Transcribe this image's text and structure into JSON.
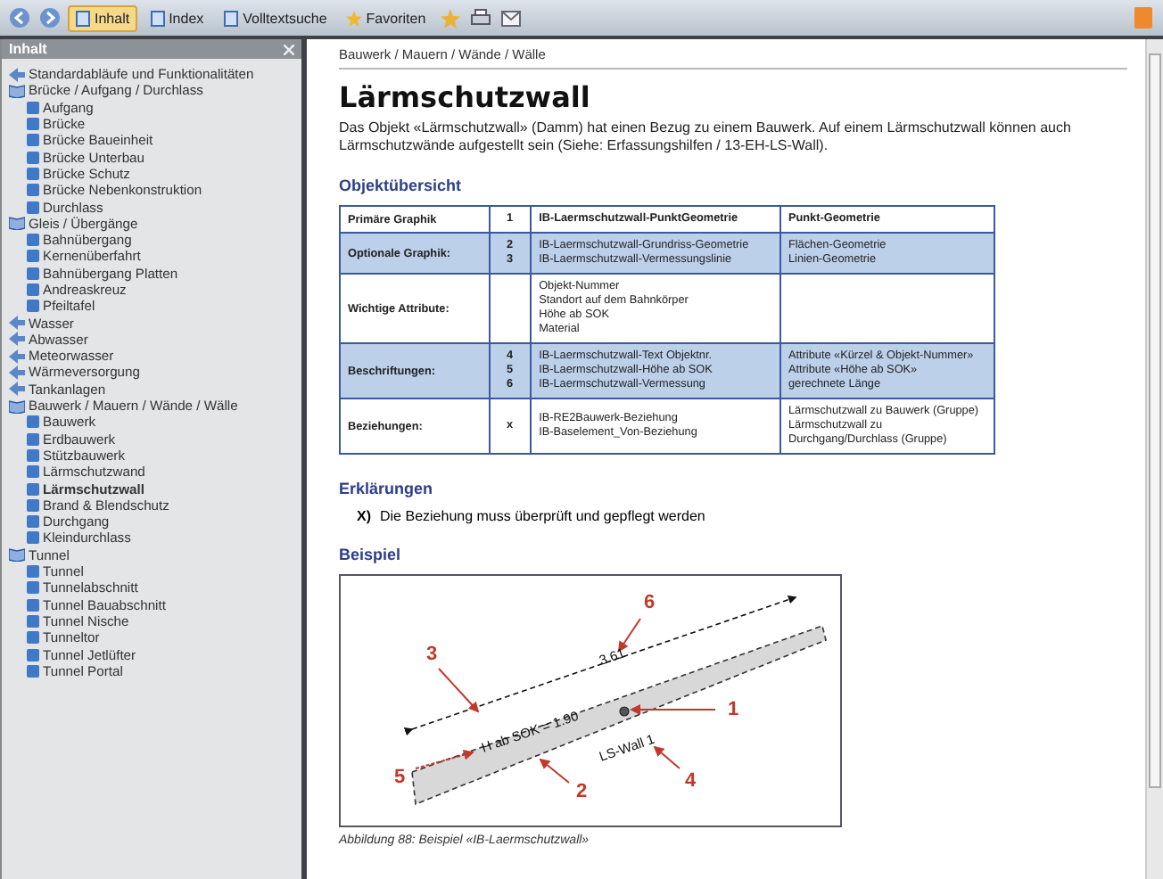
{
  "toolbar": {
    "tabs": [
      {
        "label": "Inhalt",
        "selected": true
      },
      {
        "label": "Index",
        "selected": false
      },
      {
        "label": "Volltextsuche",
        "selected": false
      },
      {
        "label": "Favoriten",
        "selected": false
      }
    ]
  },
  "sidebar": {
    "title": "Inhalt",
    "items": [
      {
        "kind": "doc",
        "label": "Standardabläufe und Funktionalitäten",
        "selected": false
      },
      {
        "kind": "book",
        "label": "Brücke / Aufgang / Durchlass",
        "selected": false,
        "children": [
          {
            "label": "Aufgang",
            "selected": false
          },
          {
            "label": "Brücke",
            "selected": false
          },
          {
            "label": "Brücke Baueinheit",
            "selected": false
          },
          {
            "label": "Brücke Unterbau",
            "selected": false
          },
          {
            "label": "Brücke Schutz",
            "selected": false
          },
          {
            "label": "Brücke Nebenkonstruktion",
            "selected": false
          },
          {
            "label": "Durchlass",
            "selected": false
          }
        ]
      },
      {
        "kind": "book",
        "label": "Gleis / Übergänge",
        "selected": false,
        "children": [
          {
            "label": "Bahnübergang",
            "selected": false
          },
          {
            "label": "Kernenüberfahrt",
            "selected": false
          },
          {
            "label": "Bahnübergang Platten",
            "selected": false
          },
          {
            "label": "Andreaskreuz",
            "selected": false
          },
          {
            "label": "Pfeiltafel",
            "selected": false
          }
        ]
      },
      {
        "kind": "doc",
        "label": "Wasser",
        "selected": false
      },
      {
        "kind": "doc",
        "label": "Abwasser",
        "selected": false
      },
      {
        "kind": "doc",
        "label": "Meteorwasser",
        "selected": false
      },
      {
        "kind": "doc",
        "label": "Wärmeversorgung",
        "selected": false
      },
      {
        "kind": "doc",
        "label": "Tankanlagen",
        "selected": false
      },
      {
        "kind": "book",
        "label": "Bauwerk / Mauern / Wände / Wälle",
        "selected": false,
        "children": [
          {
            "label": "Bauwerk",
            "selected": false
          },
          {
            "label": "Erdbauwerk",
            "selected": false
          },
          {
            "label": "Stützbauwerk",
            "selected": false
          },
          {
            "label": "Lärmschutzwand",
            "selected": false
          },
          {
            "label": "Lärmschutzwall",
            "selected": true
          },
          {
            "label": "Brand & Blendschutz",
            "selected": false
          },
          {
            "label": "Durchgang",
            "selected": false
          },
          {
            "label": "Kleindurchlass",
            "selected": false
          }
        ]
      },
      {
        "kind": "book",
        "label": "Tunnel",
        "selected": false,
        "children": [
          {
            "label": "Tunnel",
            "selected": false
          },
          {
            "label": "Tunnelabschnitt",
            "selected": false
          },
          {
            "label": "Tunnel Bauabschnitt",
            "selected": false
          },
          {
            "label": "Tunnel Nische",
            "selected": false
          },
          {
            "label": "Tunneltor",
            "selected": false
          },
          {
            "label": "Tunnel Jetlüfter",
            "selected": false
          },
          {
            "label": "Tunnel Portal",
            "selected": false
          }
        ]
      }
    ]
  },
  "content": {
    "breadcrumb": "Bauwerk / Mauern / Wände / Wälle",
    "title": "Lärmschutzwall",
    "intro": "Das Objekt «Lärmschutzwall» (Damm) hat einen Bezug zu einem Bauwerk. Auf einem Lärmschutzwall können auch Lärmschutzwände aufgestellt sein (Siehe: Erfassungshilfen / 13-EH-LS-Wall).",
    "overview_heading": "Objektübersicht",
    "table": {
      "rows": [
        {
          "highlighted": false,
          "label": "Primäre Graphik",
          "numbers": [
            "1"
          ],
          "objects": [
            "IB-Laermschutzwall-PunktGeometrie"
          ],
          "types": [
            "Punkt-Geometrie"
          ]
        },
        {
          "highlighted": true,
          "label": "Optionale Graphik:",
          "numbers": [
            "2",
            "3"
          ],
          "objects": [
            "IB-Laermschutzwall-Grundriss-Geometrie",
            "IB-Laermschutzwall-Vermessungslinie"
          ],
          "types": [
            "Flächen-Geometrie",
            "Linien-Geometrie"
          ]
        },
        {
          "highlighted": false,
          "label": "Wichtige Attribute:",
          "numbers": [],
          "objects": [
            "Objekt-Nummer",
            "Standort auf dem Bahnkörper",
            "Höhe ab SOK",
            "Material"
          ],
          "types": []
        },
        {
          "highlighted": true,
          "label": "Beschriftungen:",
          "numbers": [
            "4",
            "5",
            "6"
          ],
          "objects": [
            "IB-Laermschutzwall-Text Objektnr.",
            "IB-Laermschutzwall-Höhe ab SOK",
            "IB-Laermschutzwall-Vermessung"
          ],
          "types": [
            "Attribute «Kürzel & Objekt-Nummer»",
            "Attribute «Höhe ab SOK»",
            "gerechnete Länge"
          ]
        },
        {
          "highlighted": false,
          "label": "Beziehungen:",
          "numbers": [
            "x"
          ],
          "objects": [
            "IB-RE2Bauwerk-Beziehung",
            "IB-Baselement_Von-Beziehung"
          ],
          "types": [
            "Lärmschutzwall zu Bauwerk (Gruppe)",
            "Lärmschutzwall zu",
            "Durchgang/Durchlass (Gruppe)"
          ]
        }
      ]
    },
    "notes_heading": "Erklärungen",
    "notes": [
      {
        "marker": "X)",
        "text": "Die Beziehung muss überprüft und gepflegt werden"
      }
    ],
    "example_heading": "Beispiel",
    "figure": {
      "labels": [
        "6",
        "3",
        "1",
        "5",
        "2",
        "4",
        "3.61",
        "H ab SOK = 1.90",
        "LS-Wall 1"
      ],
      "caption": "Abbildung 88: Beispiel «IB-Laermschutzwall»"
    }
  }
}
